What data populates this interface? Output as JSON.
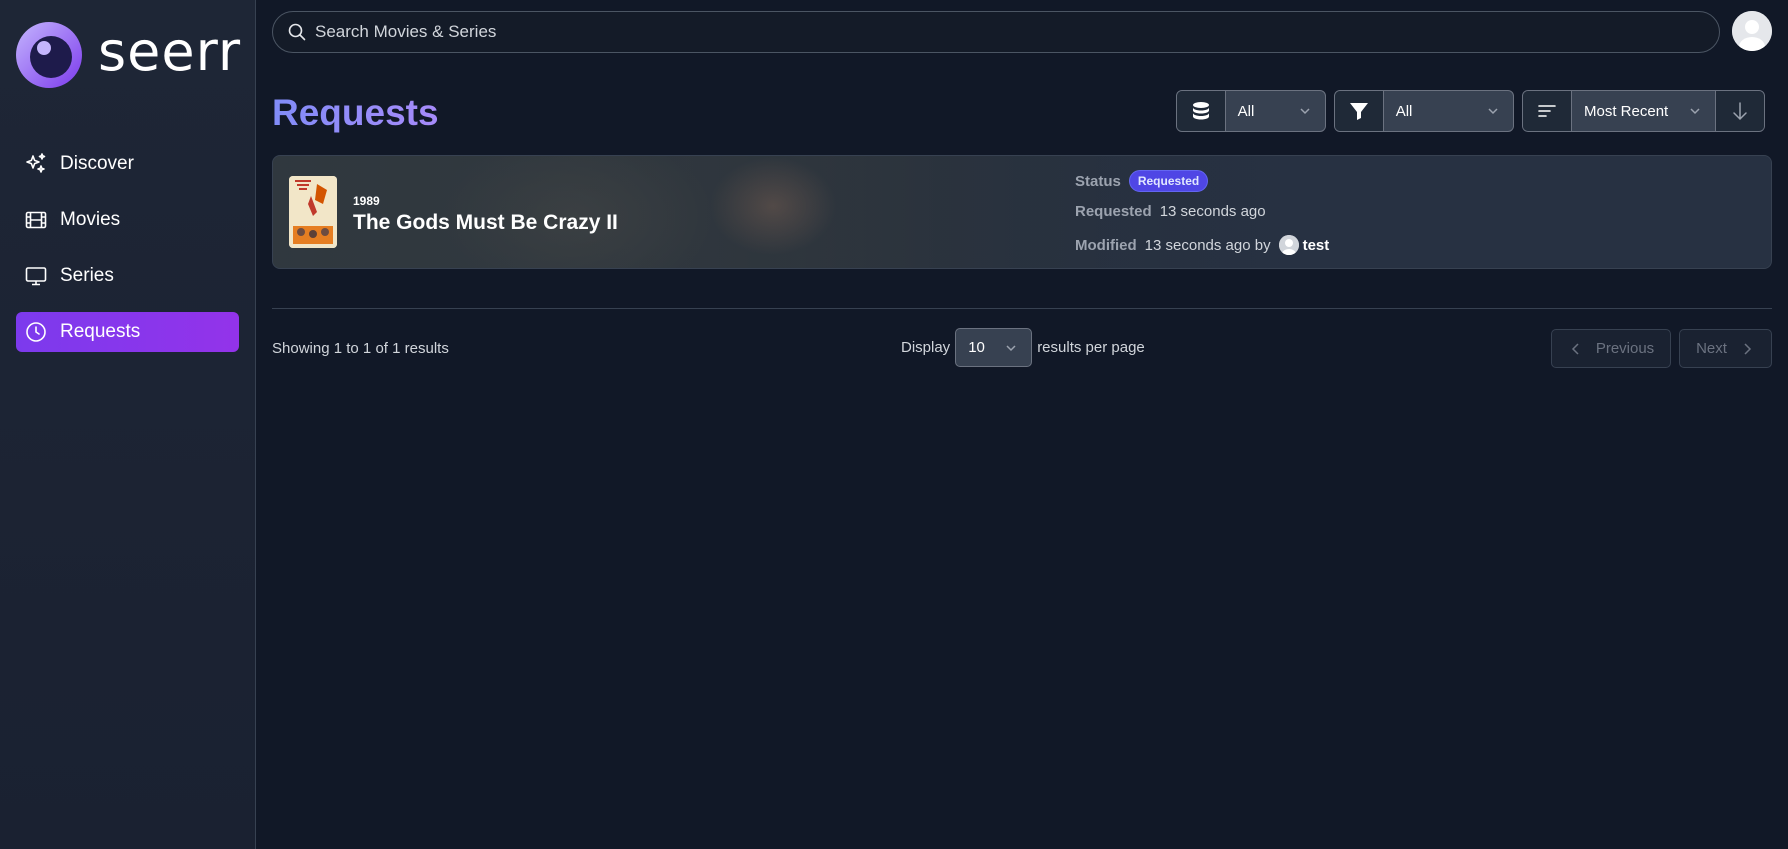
{
  "app": {
    "name": "seerr"
  },
  "sidebar": {
    "items": [
      {
        "label": "Discover",
        "icon": "sparkles-icon",
        "active": false
      },
      {
        "label": "Movies",
        "icon": "film-icon",
        "active": false
      },
      {
        "label": "Series",
        "icon": "tv-icon",
        "active": false
      },
      {
        "label": "Requests",
        "icon": "clock-icon",
        "active": true
      }
    ]
  },
  "header": {
    "search_placeholder": "Search Movies & Series"
  },
  "page": {
    "title": "Requests"
  },
  "filters": {
    "media_type": {
      "icon": "database-icon",
      "value": "All"
    },
    "status": {
      "icon": "filter-icon",
      "value": "All"
    },
    "sort": {
      "icon": "sort-lines-icon",
      "value": "Most Recent",
      "direction_icon": "arrow-down-icon"
    }
  },
  "requests": [
    {
      "year": "1989",
      "title": "The Gods Must Be Crazy II",
      "status_label": "Status",
      "status": "Requested",
      "requested_label": "Requested",
      "requested_time": "13 seconds ago",
      "modified_label": "Modified",
      "modified_time": "13 seconds ago by",
      "modified_by": "test"
    }
  ],
  "pagination": {
    "showing_prefix": "Showing",
    "from": "1",
    "to_word": "to",
    "to": "1",
    "of_word": "of",
    "total": "1",
    "results_word": "results",
    "display_label": "Display",
    "per_page": "10",
    "per_page_suffix": "results per page",
    "previous": "Previous",
    "next": "Next"
  },
  "colors": {
    "background": "#111827",
    "accent": "#7c3aed",
    "title_gradient": [
      "#818cf8",
      "#a78bfa"
    ],
    "badge": "#4f46e5"
  }
}
